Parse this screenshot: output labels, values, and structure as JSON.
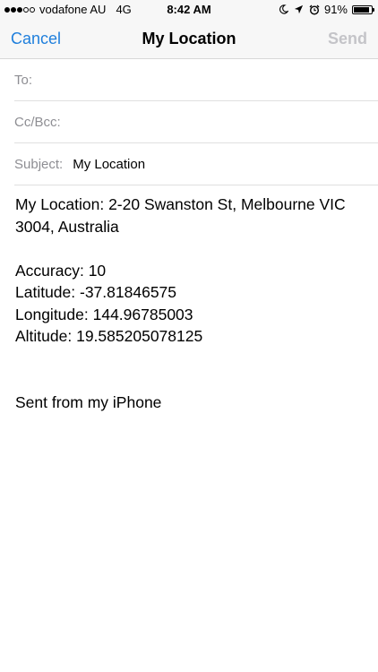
{
  "status_bar": {
    "signal_filled": 3,
    "signal_total": 5,
    "carrier": "vodafone AU",
    "network": "4G",
    "time": "8:42 AM",
    "icons": [
      "moon-icon",
      "location-arrow-icon",
      "alarm-icon"
    ],
    "battery_percent": "91%",
    "battery_level": 0.91
  },
  "nav": {
    "cancel": "Cancel",
    "title": "My Location",
    "send": "Send"
  },
  "fields": {
    "to_label": "To:",
    "to_value": "",
    "ccbcc_label": "Cc/Bcc:",
    "ccbcc_value": "",
    "subject_label": "Subject:",
    "subject_value": "My Location"
  },
  "body": {
    "location": "My Location: 2-20 Swanston St, Melbourne VIC 3004, Australia",
    "accuracy": "Accuracy: 10",
    "latitude": "Latitude: -37.81846575",
    "longitude": "Longitude: 144.96785003",
    "altitude": "Altitude: 19.585205078125",
    "signature": "Sent from my iPhone"
  },
  "colors": {
    "accent": "#1f7fdc",
    "disabled": "#c4c4c8",
    "label_gray": "#8e8e93",
    "bar_bg": "#f7f7f7"
  }
}
